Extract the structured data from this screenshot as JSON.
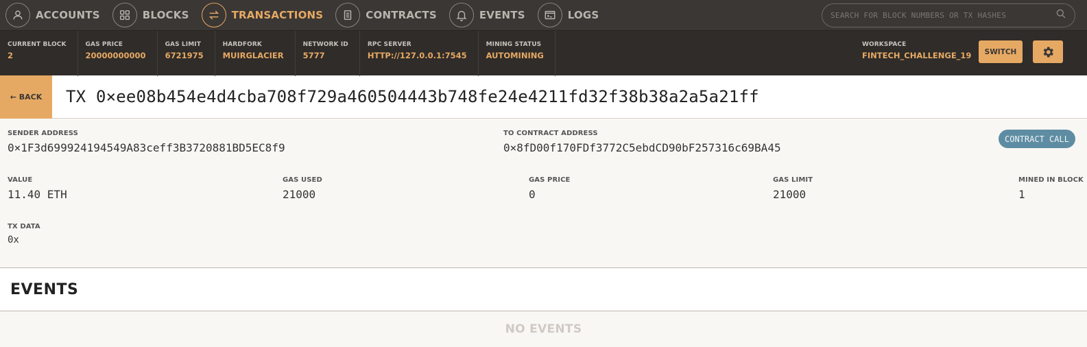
{
  "nav": {
    "items": [
      {
        "label": "ACCOUNTS",
        "icon": "person-icon",
        "active": false
      },
      {
        "label": "BLOCKS",
        "icon": "grid-icon",
        "active": false
      },
      {
        "label": "TRANSACTIONS",
        "icon": "swap-arrows-icon",
        "active": true
      },
      {
        "label": "CONTRACTS",
        "icon": "document-icon",
        "active": false
      },
      {
        "label": "EVENTS",
        "icon": "bell-icon",
        "active": false
      },
      {
        "label": "LOGS",
        "icon": "terminal-icon",
        "active": false
      }
    ],
    "search_placeholder": "SEARCH FOR BLOCK NUMBERS OR TX HASHES"
  },
  "status": {
    "items": [
      {
        "label": "CURRENT BLOCK",
        "value": "2"
      },
      {
        "label": "GAS PRICE",
        "value": "20000000000"
      },
      {
        "label": "GAS LIMIT",
        "value": "6721975"
      },
      {
        "label": "HARDFORK",
        "value": "MUIRGLACIER"
      },
      {
        "label": "NETWORK ID",
        "value": "5777"
      },
      {
        "label": "RPC SERVER",
        "value": "HTTP://127.0.0.1:7545"
      },
      {
        "label": "MINING STATUS",
        "value": "AUTOMINING"
      }
    ],
    "workspace_label": "WORKSPACE",
    "workspace_value": "FINTECH_CHALLENGE_19",
    "switch_label": "SWITCH"
  },
  "tx": {
    "back_label": "← BACK",
    "title": "TX 0×ee08b454e4d4cba708f729a460504443b748fe24e4211fd32f38b38a2a5a21ff",
    "sender_label": "SENDER ADDRESS",
    "sender_value": "0×1F3d699924194549A83ceff3B3720881BD5EC8f9",
    "to_label": "TO CONTRACT ADDRESS",
    "to_value": "0×8fD00f170FDf3772C5ebdCD90bF257316c69BA45",
    "badge": "CONTRACT CALL",
    "value_label": "VALUE",
    "value_value": "11.40 ETH",
    "gas_used_label": "GAS USED",
    "gas_used_value": "21000",
    "gas_price_label": "GAS PRICE",
    "gas_price_value": "0",
    "gas_limit_label": "GAS LIMIT",
    "gas_limit_value": "21000",
    "mined_label": "MINED IN BLOCK",
    "mined_value": "1",
    "data_label": "TX DATA",
    "data_value": "0x"
  },
  "events": {
    "heading": "EVENTS",
    "empty": "NO EVENTS"
  },
  "colors": {
    "accent": "#e6a964",
    "nav_bg": "#3b3734",
    "status_bg": "#2f2c29",
    "badge": "#5e8da3"
  }
}
